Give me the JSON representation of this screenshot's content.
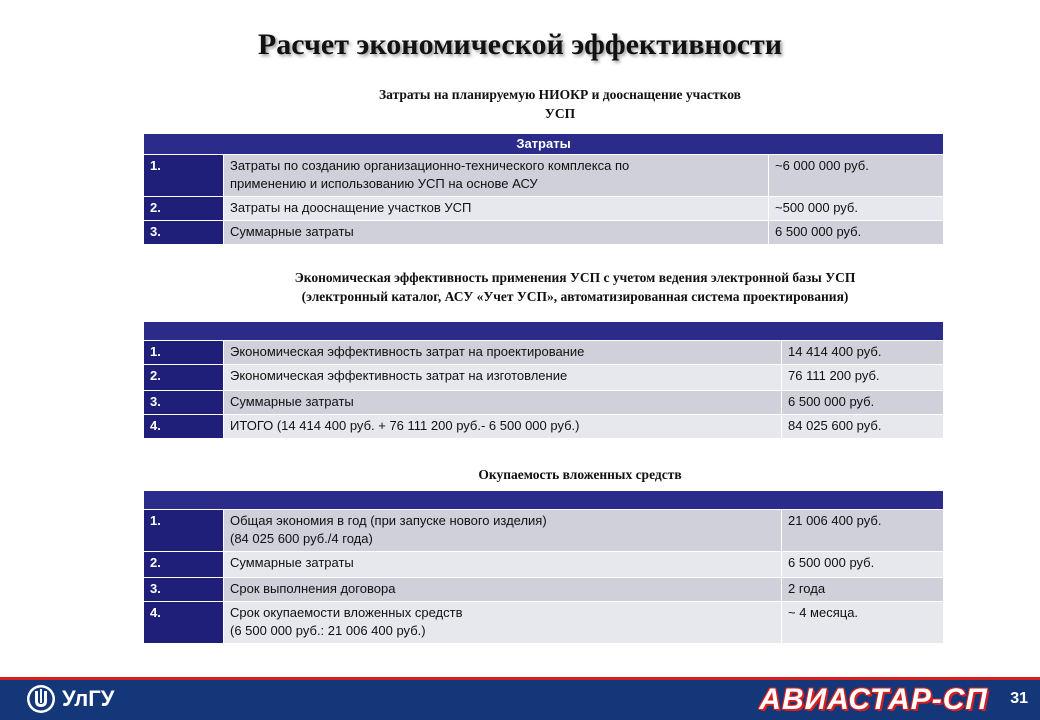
{
  "title": "Расчет экономической эффективности",
  "section1": {
    "subtitle_line1": "Затраты на планируемую НИОКР и дооснащение участков",
    "subtitle_line2": "УСП",
    "header": "Затраты",
    "rows": [
      {
        "num": "1.",
        "text1": "Затраты по созданию организационно-технического комплекса по",
        "text2": "применению и использованию УСП на основе АСУ",
        "value": "~6 000 000 руб."
      },
      {
        "num": "2.",
        "text1": "Затраты на дооснащение  участков УСП",
        "text2": "",
        "value": "~500 000 руб."
      },
      {
        "num": "3.",
        "text1": "Суммарные затраты",
        "text2": "",
        "value": "6 500 000 руб."
      }
    ]
  },
  "section2": {
    "subtitle_line1": "Экономическая эффективность применения УСП с учетом ведения электронной базы УСП",
    "subtitle_line2": "(электронный каталог, АСУ «Учет УСП», автоматизированная система проектирования)",
    "header": "",
    "rows": [
      {
        "num": "1.",
        "text1": "Экономическая эффективность затрат на проектирование",
        "text2": "",
        "value": "14 414 400 руб."
      },
      {
        "num": "2.",
        "text1": "Экономическая эффективность затрат на изготовление",
        "text2": "",
        "value": "76 111 200 руб."
      },
      {
        "num": "3.",
        "text1": "Суммарные затраты",
        "text2": "",
        "value": "6 500 000 руб."
      },
      {
        "num": "4.",
        "text1": "ИТОГО (14 414 400 руб. + 76 111 200 руб.- 6 500 000 руб.)",
        "text2": "",
        "value": "84 025 600 руб."
      }
    ]
  },
  "section3": {
    "subtitle_line1": "Окупаемость вложенных средств",
    "header": "",
    "rows": [
      {
        "num": "1.",
        "text1": "Общая экономия в год (при запуске нового изделия)",
        "text2": "(84 025 600 руб./4 года)",
        "value": "21 006 400 руб."
      },
      {
        "num": "2.",
        "text1": "Суммарные затраты",
        "text2": "",
        "value": "6 500 000 руб."
      },
      {
        "num": "3.",
        "text1": "Срок выполнения договора",
        "text2": "",
        "value": "2 года"
      },
      {
        "num": "4.",
        "text1": "Срок окупаемости вложенных  средств",
        "text2": "(6 500 000 руб.: 21 006 400 руб.)",
        "value": "~ 4 месяца."
      }
    ]
  },
  "footer": {
    "university": "УлГУ",
    "brand": "АВИАСТАР-СП",
    "page_number": "31"
  },
  "colors": {
    "navy": "#1f1f7a",
    "footer_blue": "#14377a",
    "accent_red": "#d91e1e",
    "row_dark": "#cfd0da",
    "row_light": "#e7e8ee"
  }
}
